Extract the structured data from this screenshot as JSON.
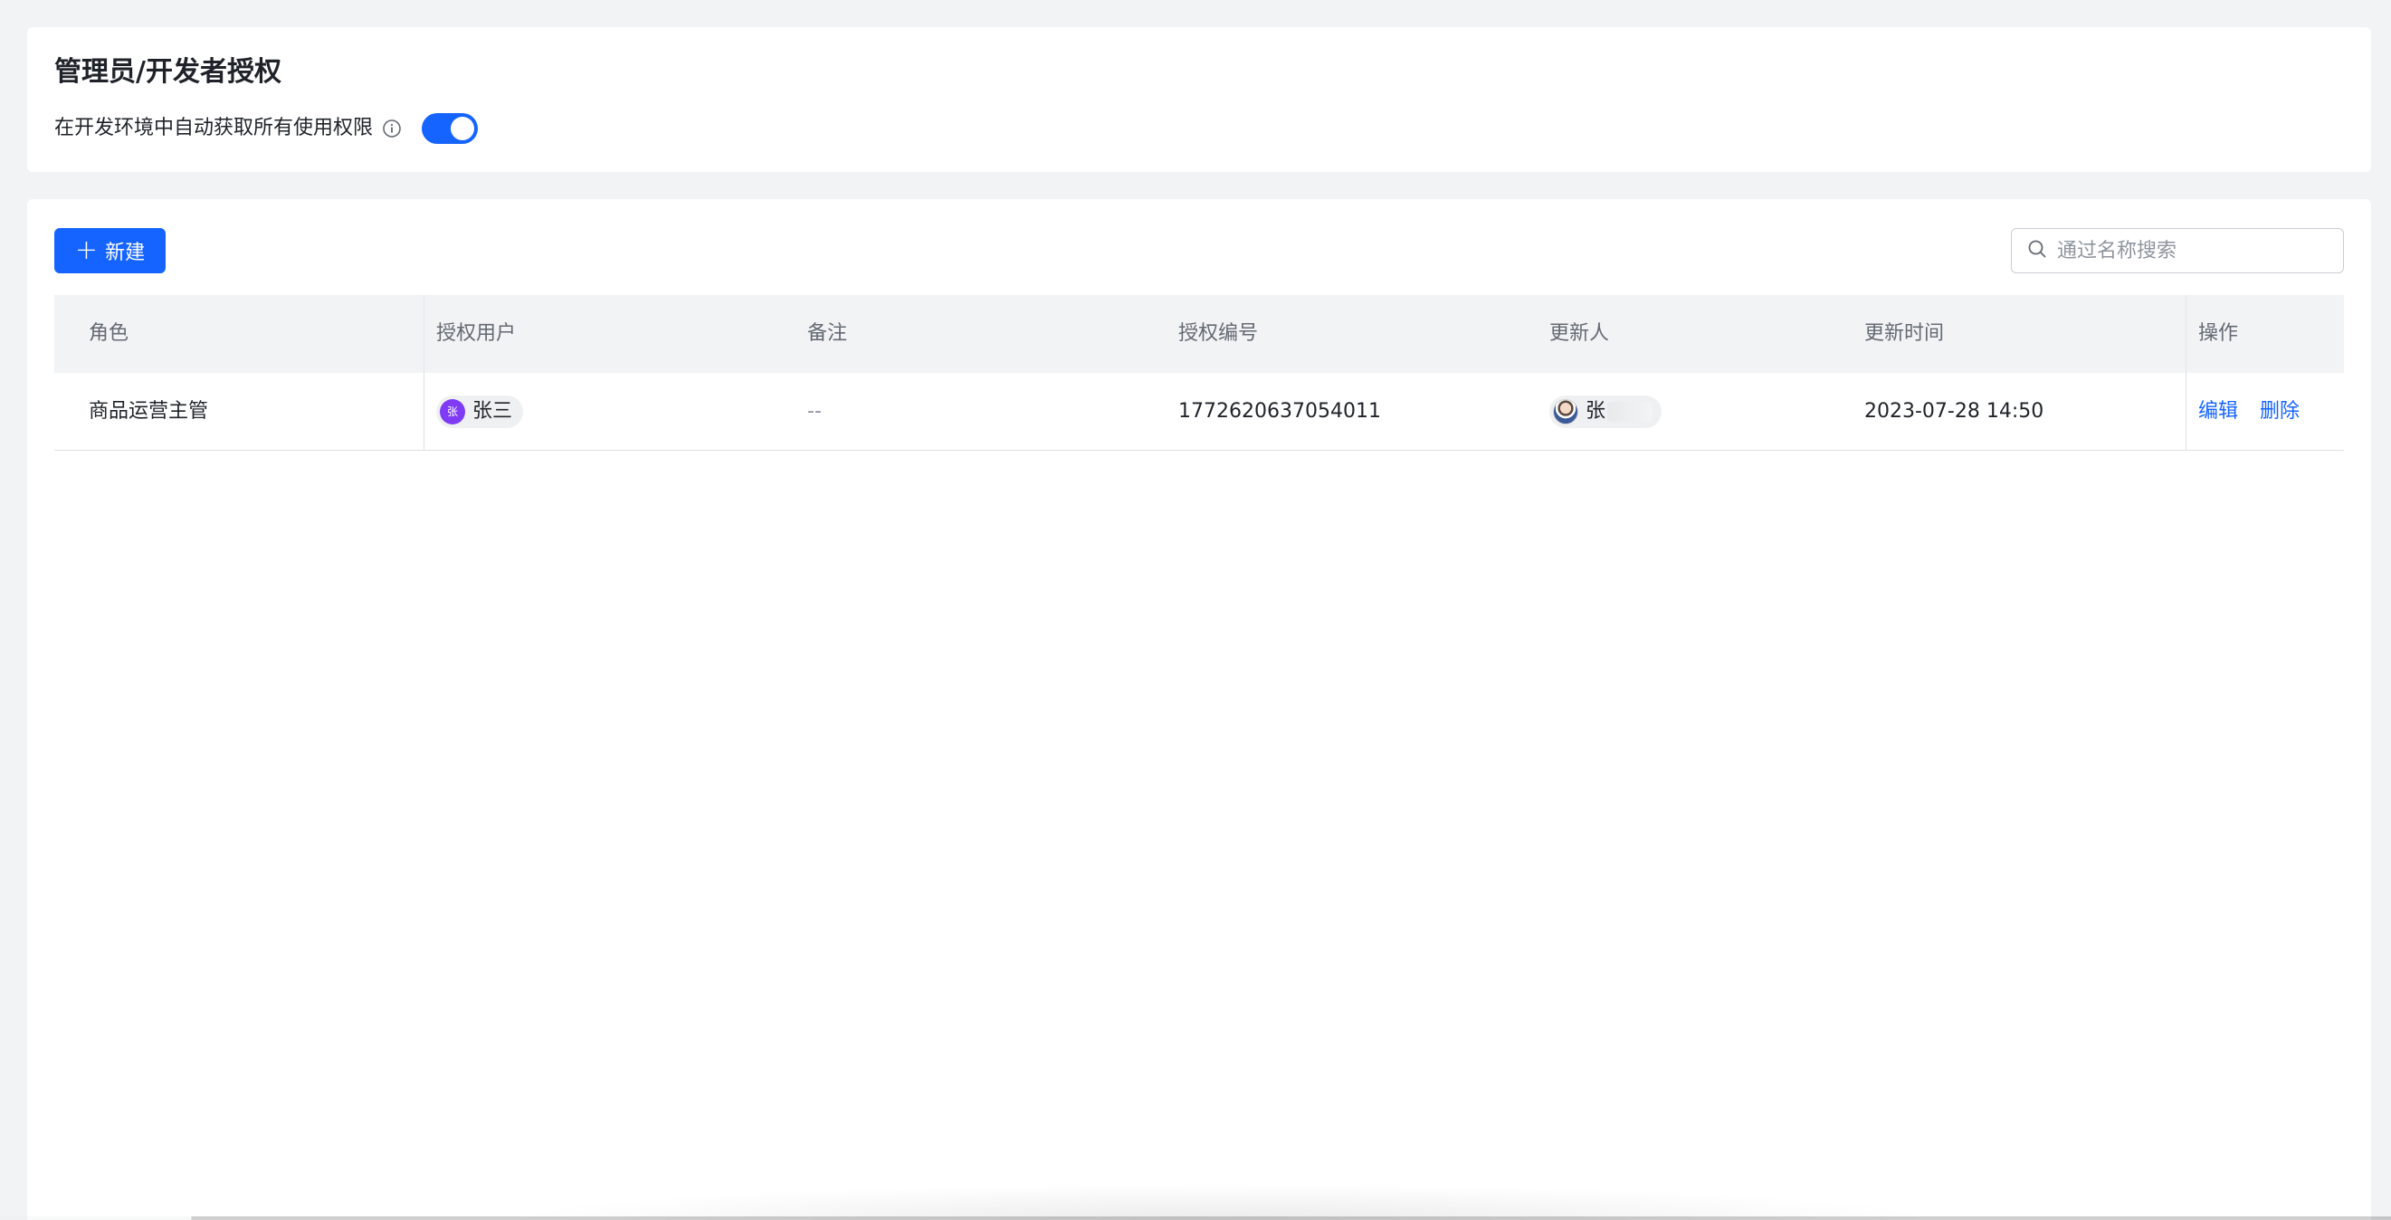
{
  "header": {
    "title": "管理员/开发者授权",
    "setting_label": "在开发环境中自动获取所有使用权限",
    "toggle_on": true
  },
  "toolbar": {
    "new_button_label": "新建",
    "search_placeholder": "通过名称搜索"
  },
  "table": {
    "columns": [
      "角色",
      "授权用户",
      "备注",
      "授权编号",
      "更新人",
      "更新时间",
      "操作"
    ],
    "rows": [
      {
        "role": "商品运营主管",
        "user_avatar_letter": "张",
        "user_name": "张三",
        "note": "--",
        "auth_id": "1772620637054011",
        "updater": "张",
        "updated_at": "2023-07-28 14:50",
        "actions": {
          "edit": "编辑",
          "delete": "删除"
        }
      }
    ]
  },
  "colors": {
    "primary": "#1664ff",
    "avatar_purple": "#7f3bf5",
    "header_bg": "#f2f3f5"
  },
  "icons": {
    "info": "info-icon",
    "search": "search-icon",
    "plus": "plus-icon"
  }
}
